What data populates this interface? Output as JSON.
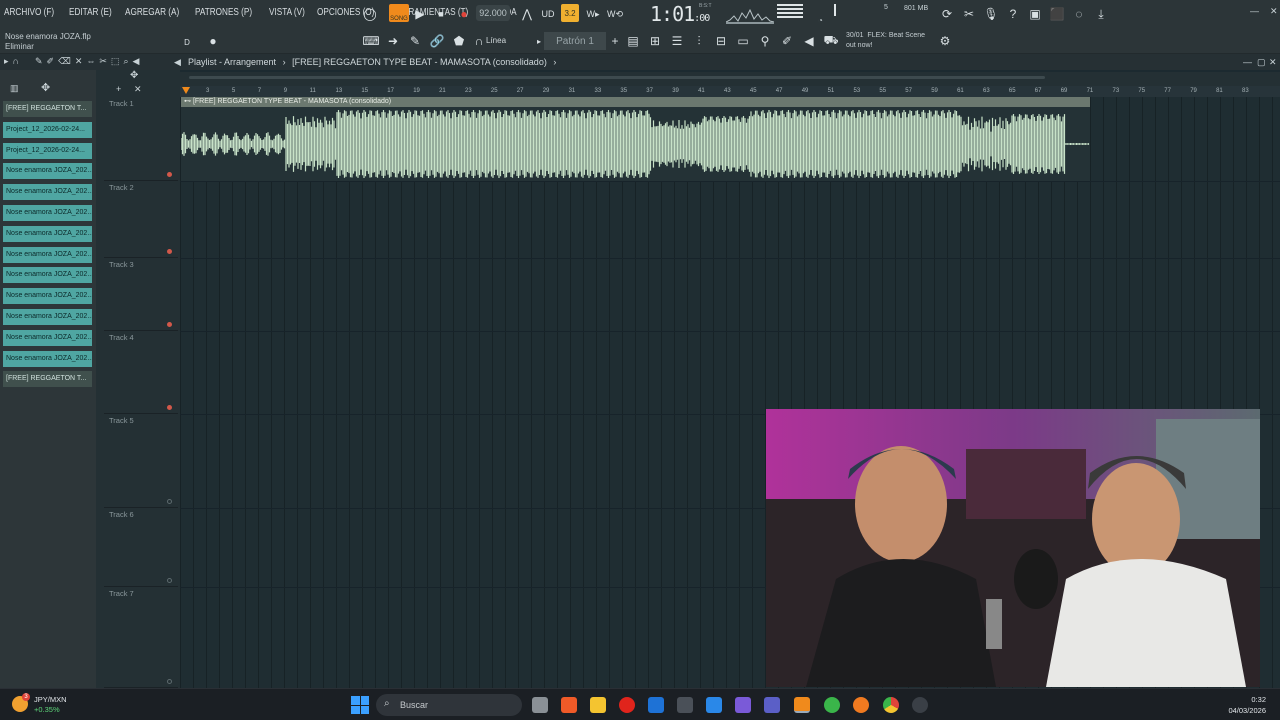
{
  "menu": [
    "ARCHIVO (F)",
    "EDITAR (E)",
    "AGREGAR (A)",
    "PATRONES (P)",
    "VISTA (V)",
    "OPCIONES (O)",
    "HERRAMIENTAS (T)",
    "AYUDA"
  ],
  "project": {
    "file": "Nose enamora JOZA.flp",
    "hint": "Eliminar"
  },
  "transport": {
    "song_label": "SONG",
    "tempo": "92.000",
    "time": "1:01",
    "time_sub": ":00",
    "time_tag": "B:S:T",
    "memory": "801 MB",
    "memory_sub": "5",
    "step": "3.2"
  },
  "toolbar": {
    "snap": "Línea",
    "pattern": "Patrón 1",
    "news_count": "30/01",
    "news": "FLEX: Beat Scene",
    "news2": "out now!"
  },
  "playlist": {
    "title": "Playlist - Arrangement",
    "breadcrumb": "[FREE] REGGAETON TYPE BEAT - MAMASOTA (consolidado)"
  },
  "clips": [
    "[FREE] REGGAETON T...",
    "Project_12_2026-02-24...",
    "Project_12_2026-02-24...",
    "Nose enamora JOZA_202...",
    "Nose enamora JOZA_202...",
    "Nose enamora JOZA_202...",
    "Nose enamora JOZA_202...",
    "Nose enamora JOZA_202...",
    "Nose enamora JOZA_202...",
    "Nose enamora JOZA_202...",
    "Nose enamora JOZA_202...",
    "Nose enamora JOZA_202...",
    "Nose enamora JOZA_202...",
    "[FREE] REGGAETON T..."
  ],
  "tracks": [
    "Track 1",
    "Track 2",
    "Track 3",
    "Track 4",
    "Track 5",
    "Track 6",
    "Track 7"
  ],
  "ruler": [
    "3",
    "5",
    "7",
    "9",
    "11",
    "13",
    "15",
    "17",
    "19",
    "21",
    "23",
    "25",
    "27",
    "29",
    "31",
    "33",
    "35",
    "37",
    "39",
    "41",
    "43",
    "45",
    "47",
    "49",
    "51",
    "53",
    "55",
    "57",
    "59",
    "61",
    "63",
    "65",
    "67",
    "69",
    "71",
    "73",
    "75",
    "77",
    "79",
    "81",
    "83"
  ],
  "arrangement_clip": {
    "title": "[FREE] REGGAETON TYPE BEAT - MAMASOTA (consolidado)",
    "wave_color": "#c8e2c8"
  },
  "taskbar": {
    "ticker": "JPY/MXN",
    "ticker_change": "+0.35%",
    "search": "Buscar",
    "time": "0:32",
    "date": "04/03/2026",
    "badge": "3"
  },
  "colors": {
    "accent": "#f08a1c",
    "clip": "#4fa6a2",
    "record": "#e0443a"
  }
}
